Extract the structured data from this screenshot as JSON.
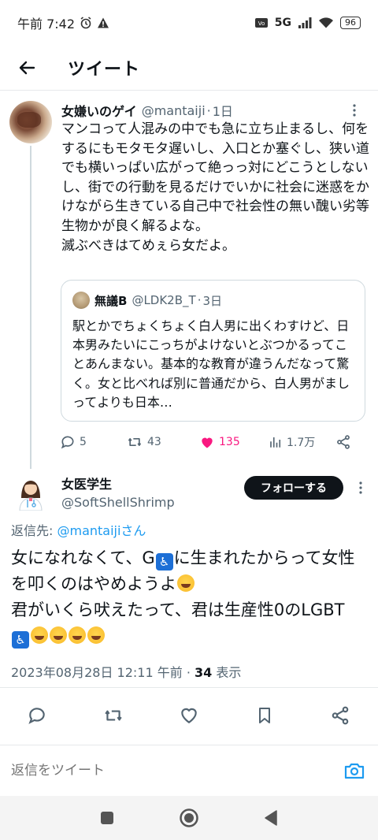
{
  "status_bar": {
    "time": "午前 7:42",
    "network": "5G",
    "battery": "96",
    "icons": [
      "alarm-icon",
      "warning-icon",
      "volte-icon",
      "signal-icon",
      "wifi-icon",
      "battery-icon"
    ]
  },
  "header": {
    "title": "ツイート",
    "back_icon": "arrow-left-icon"
  },
  "tweet": {
    "author_name": "女嫌いのゲイ",
    "author_handle": "@mantaiji",
    "time": "1日",
    "text_lines": [
      "マンコって人混みの中でも急に立ち止まるし、何をするにもモタモタ遅いし、入口とか塞ぐし、狭い道でも横いっぱい広がって絶っっ対にどこうとしないし、街での行動を見るだけでいかに社会に迷惑をかけながら生きている自己中で社会性の無い醜い劣等生物かが良く解るよな。",
      "滅ぶべきはてめぇら女だよ。"
    ],
    "quote": {
      "author_name": "無議B",
      "author_handle": "@LDK2B_T",
      "time": "3日",
      "text": "駅とかでちょくちょく白人男に出くわすけど、日本男みたいにこっちがよけないとぶつかるってことあんまない。基本的な教育が違うんだなって驚く。女と比べれば別に普通だから、白人男がましってよりも日本…"
    },
    "stats": {
      "replies": "5",
      "retweets": "43",
      "likes": "135",
      "views": "1.7万"
    }
  },
  "reply": {
    "author_name": "女医学生",
    "author_handle": "@SoftShellShrimp",
    "follow_label": "フォローする",
    "reply_to_prefix": "返信先: ",
    "reply_to_mention": "@mantaijiさん",
    "line1_a": "女になれなくて、G",
    "line1_b": "に生まれたからって女性を叩くのはやめようよ",
    "line2": "君がいくら吠えたって、君は生産性0のLGBT",
    "date": "2023年08月28日 12:11 午前",
    "sep": " · ",
    "views_count": "34",
    "views_label": " 表示"
  },
  "reply_bar": {
    "placeholder": "返信をツイート"
  },
  "colors": {
    "like": "#f91880",
    "link": "#1d9bf0",
    "text": "#0f1419",
    "muted": "#536471",
    "border": "#cfd9de"
  }
}
